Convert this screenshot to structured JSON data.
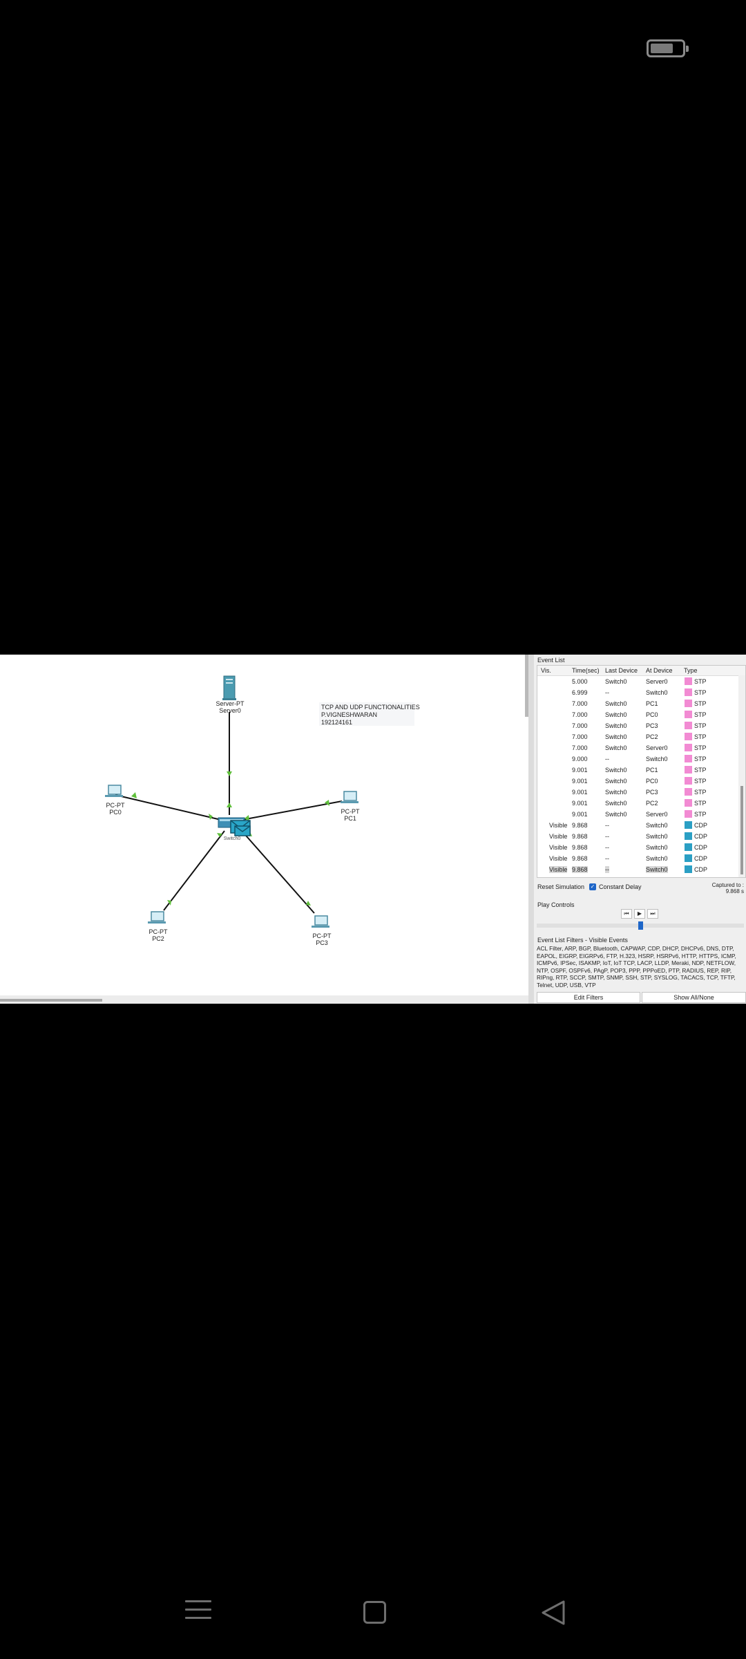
{
  "workspace": {
    "note": [
      "TCP AND UDP FUNCTIONALITIES",
      "P.VIGNESHWARAN",
      "192124161"
    ],
    "devices": {
      "server0": {
        "type": "Server-PT",
        "name": "Server0"
      },
      "pc0": {
        "type": "PC-PT",
        "name": "PC0"
      },
      "pc1": {
        "type": "PC-PT",
        "name": "PC1"
      },
      "pc2": {
        "type": "PC-PT",
        "name": "PC2"
      },
      "pc3": {
        "type": "PC-PT",
        "name": "PC3"
      },
      "switch0": {
        "name": "Switch0"
      }
    }
  },
  "event_list": {
    "title": "Event List",
    "columns": [
      "Vis.",
      "Time(sec)",
      "Last Device",
      "At Device",
      "Type"
    ],
    "rows": [
      {
        "vis": "",
        "time": "5.000",
        "last": "Switch0",
        "at": "Server0",
        "type": "STP",
        "color": "#f28bd3"
      },
      {
        "vis": "",
        "time": "6.999",
        "last": "--",
        "at": "Switch0",
        "type": "STP",
        "color": "#f28bd3"
      },
      {
        "vis": "",
        "time": "7.000",
        "last": "Switch0",
        "at": "PC1",
        "type": "STP",
        "color": "#f28bd3"
      },
      {
        "vis": "",
        "time": "7.000",
        "last": "Switch0",
        "at": "PC0",
        "type": "STP",
        "color": "#f28bd3"
      },
      {
        "vis": "",
        "time": "7.000",
        "last": "Switch0",
        "at": "PC3",
        "type": "STP",
        "color": "#f28bd3"
      },
      {
        "vis": "",
        "time": "7.000",
        "last": "Switch0",
        "at": "PC2",
        "type": "STP",
        "color": "#f28bd3"
      },
      {
        "vis": "",
        "time": "7.000",
        "last": "Switch0",
        "at": "Server0",
        "type": "STP",
        "color": "#f28bd3"
      },
      {
        "vis": "",
        "time": "9.000",
        "last": "--",
        "at": "Switch0",
        "type": "STP",
        "color": "#f28bd3"
      },
      {
        "vis": "",
        "time": "9.001",
        "last": "Switch0",
        "at": "PC1",
        "type": "STP",
        "color": "#f28bd3"
      },
      {
        "vis": "",
        "time": "9.001",
        "last": "Switch0",
        "at": "PC0",
        "type": "STP",
        "color": "#f28bd3"
      },
      {
        "vis": "",
        "time": "9.001",
        "last": "Switch0",
        "at": "PC3",
        "type": "STP",
        "color": "#f28bd3"
      },
      {
        "vis": "",
        "time": "9.001",
        "last": "Switch0",
        "at": "PC2",
        "type": "STP",
        "color": "#f28bd3"
      },
      {
        "vis": "",
        "time": "9.001",
        "last": "Switch0",
        "at": "Server0",
        "type": "STP",
        "color": "#f28bd3"
      },
      {
        "vis": "Visible",
        "time": "9.868",
        "last": "--",
        "at": "Switch0",
        "type": "CDP",
        "color": "#2b9fc4"
      },
      {
        "vis": "Visible",
        "time": "9.868",
        "last": "--",
        "at": "Switch0",
        "type": "CDP",
        "color": "#2b9fc4"
      },
      {
        "vis": "Visible",
        "time": "9.868",
        "last": "--",
        "at": "Switch0",
        "type": "CDP",
        "color": "#2b9fc4"
      },
      {
        "vis": "Visible",
        "time": "9.868",
        "last": "--",
        "at": "Switch0",
        "type": "CDP",
        "color": "#2b9fc4"
      },
      {
        "vis": "Visible",
        "time": "9.868",
        "last": "--",
        "at": "Switch0",
        "type": "CDP",
        "color": "#2b9fc4"
      }
    ]
  },
  "simulation": {
    "reset_label": "Reset Simulation",
    "constant_delay_label": "Constant Delay",
    "captured_label": "Captured to :",
    "captured_value": "9.868 s"
  },
  "play_controls": {
    "title": "Play Controls",
    "back_icon": "⏮",
    "play_icon": "▶",
    "forward_icon": "⏭",
    "speed_fraction": 0.5
  },
  "filters": {
    "title": "Event List Filters - Visible Events",
    "text": "ACL Filter, ARP, BGP, Bluetooth, CAPWAP, CDP, DHCP, DHCPv6, DNS, DTP, EAPOL, EIGRP, EIGRPv6, FTP, H.323, HSRP, HSRPv6, HTTP, HTTPS, ICMP, ICMPv6, IPSec, ISAKMP, IoT, IoT TCP, LACP, LLDP, Meraki, NDP, NETFLOW, NTP, OSPF, OSPFv6, PAgP, POP3, PPP, PPPoED, PTP, RADIUS, REP, RIP, RIPng, RTP, SCCP, SMTP, SNMP, SSH, STP, SYSLOG, TACACS, TCP, TFTP, Telnet, UDP, USB, VTP",
    "edit_label": "Edit Filters",
    "show_all_label": "Show All/None"
  }
}
